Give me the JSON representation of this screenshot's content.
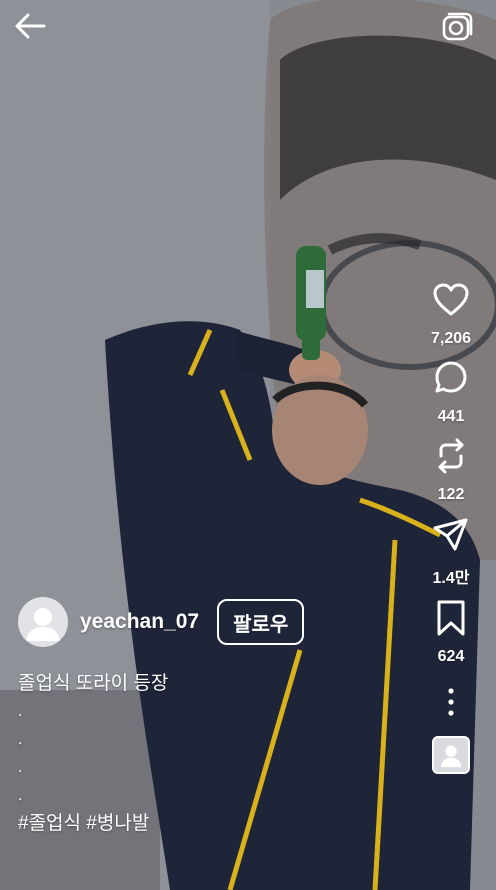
{
  "top_bar": {
    "back_icon": "arrow-left-icon",
    "camera_icon": "camera-icon"
  },
  "actions": {
    "like": {
      "icon": "heart-icon",
      "count": "7,206"
    },
    "comment": {
      "icon": "comment-icon",
      "count": "441"
    },
    "repost": {
      "icon": "repost-icon",
      "count": "122"
    },
    "share": {
      "icon": "send-icon",
      "count": "1.4만"
    },
    "save": {
      "icon": "bookmark-icon",
      "count": "624"
    },
    "more_icon": "more-vertical-icon",
    "audio_icon": "audio-avatar-icon"
  },
  "author": {
    "username": "yeachan_07",
    "follow_label": "팔로우"
  },
  "caption": {
    "title": "졸업식 또라이 등장",
    "dots": [
      ".",
      ".",
      ".",
      "."
    ],
    "hashtags": "#졸업식 #병나발"
  },
  "colors": {
    "text": "#ffffff",
    "avatar_bg": "#e1e3e7",
    "gown": "#1f2538",
    "gown_stripe": "#d9b21b",
    "bottle": "#2e6b38"
  }
}
